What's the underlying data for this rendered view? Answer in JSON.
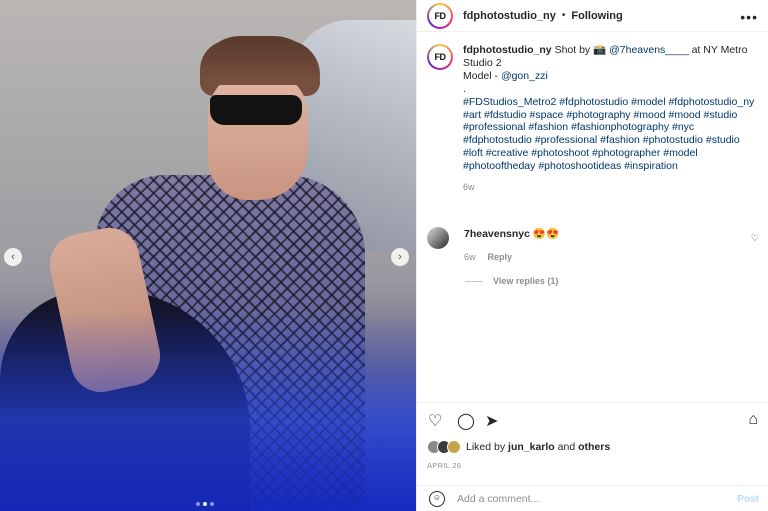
{
  "post": {
    "username": "fdphotostudio_ny",
    "follow_sep": "•",
    "follow_label": "Following",
    "more_icon": "more-horizontal-icon",
    "avatar_text": "FD",
    "avatar_subtext": "PHOTO STUDIO"
  },
  "caption": {
    "username": "fdphotostudio_ny",
    "line1_prefix": " Shot by ",
    "camera_emoji": "📸",
    "line1_mention": "@7heavens____",
    "line1_suffix": " at NY Metro Studio 2",
    "line2_prefix": "Model - ",
    "line2_mention": "@gon_zzi",
    "dot": ".",
    "hashtags": "#FDStudios_Metro2 #fdphotostudio #model #fdphotostudio_ny #art #fdstudio #space #photography #mood #mood #studio #professional #fashion #fashionphotography #nyc #fdphotostudio #professional #fashion #photostudio #studio #loft #creative #photoshoot #photographer #model #photooftheday #photoshootideas #inspiration",
    "time": "6w"
  },
  "comment": {
    "username": "7heavensnyc",
    "text": " 😍😍",
    "time": "6w",
    "reply_label": "Reply",
    "view_replies": "View replies (1)"
  },
  "likes": {
    "prefix": "Liked by ",
    "user": "jun_karlo",
    "middle": " and ",
    "others": "others"
  },
  "date": "APRIL 26",
  "add_comment": {
    "placeholder": "Add a comment...",
    "post_label": "Post"
  },
  "nav": {
    "left": "‹",
    "right": "›"
  }
}
